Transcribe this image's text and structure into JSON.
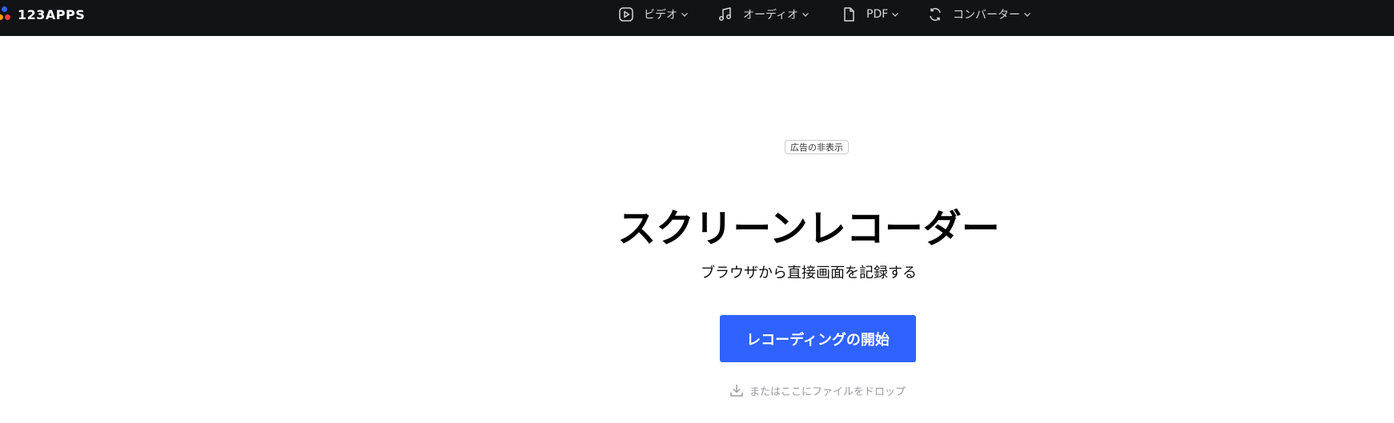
{
  "brand": {
    "logo_text": "123APPS",
    "colors": {
      "topbar": "#121317",
      "accent": "#2f62ff",
      "dot_blue": "#2f62ff",
      "dot_orange": "#ff7a00",
      "dot_red": "#ff3b3b"
    }
  },
  "nav": {
    "items": [
      {
        "label": "ビデオ",
        "icon": "play-icon"
      },
      {
        "label": "オーディオ",
        "icon": "music-note-icon"
      },
      {
        "label": "PDF",
        "icon": "document-icon"
      },
      {
        "label": "コンバーター",
        "icon": "convert-icon"
      }
    ]
  },
  "ad": {
    "label": "広告の非表示"
  },
  "hero": {
    "title": "スクリーンレコーダー",
    "subtitle": "ブラウザから直接画面を記録する",
    "start_button_label": "レコーディングの開始",
    "drop_text": "またはここにファイルをドロップ"
  }
}
